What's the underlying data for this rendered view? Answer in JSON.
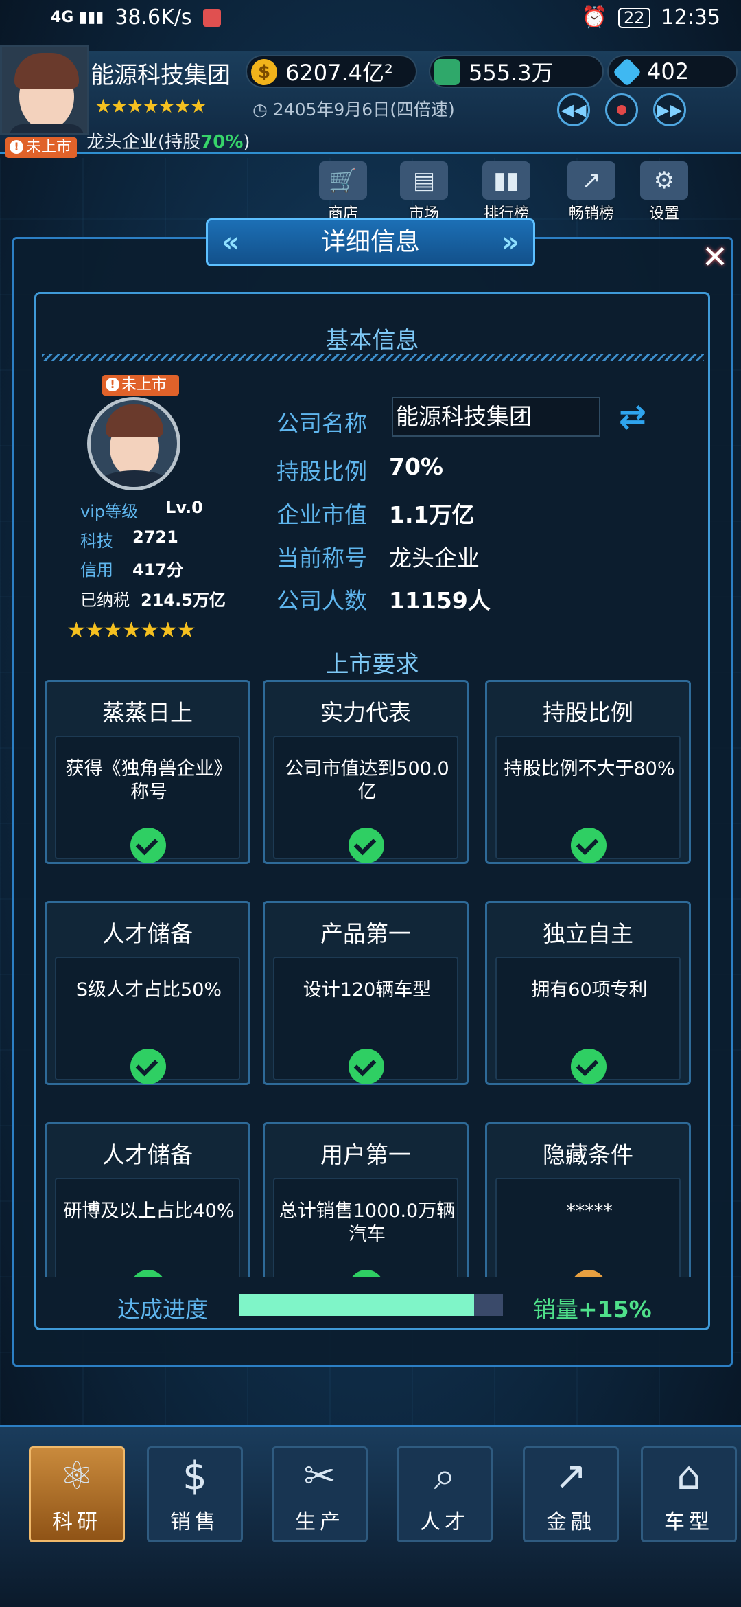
{
  "status_bar": {
    "network": "4G",
    "speed": "38.6K/s",
    "battery": "22",
    "time": "12:35"
  },
  "header": {
    "company_name": "能源科技集团",
    "gold": "6207.4亿²",
    "cash": "555.3万",
    "diamonds": "402",
    "stars": "★★★★★★★",
    "date": "2405年9月6日(四倍速)",
    "company_title_prefix": "龙头企业(持股",
    "company_title_percent": "70%",
    "company_title_suffix": ")",
    "listing_badge": "未上市"
  },
  "top_nav": [
    {
      "label": "商店",
      "icon": "cart-icon"
    },
    {
      "label": "市场",
      "icon": "book-icon"
    },
    {
      "label": "排行榜",
      "icon": "bar-chart-icon"
    },
    {
      "label": "畅销榜",
      "icon": "trend-chart-icon"
    },
    {
      "label": "设置",
      "icon": "gear-icon"
    }
  ],
  "dialog": {
    "title": "详细信息",
    "basic_info_title": "基本信息",
    "profile": {
      "badge": "未上市",
      "vip_label": "vip等级",
      "vip_value": "Lv.0",
      "tech_label": "科技",
      "tech_value": "2721",
      "credit_label": "信用",
      "credit_value": "417分",
      "tax_label": "已纳税",
      "tax_value": "214.5万亿",
      "stars": "★★★★★★★"
    },
    "fields": {
      "company_name_label": "公司名称",
      "company_name_value": "能源科技集团",
      "share_label": "持股比例",
      "share_value": "70%",
      "market_value_label": "企业市值",
      "market_value_value": "1.1万亿",
      "title_label": "当前称号",
      "title_value": "龙头企业",
      "staff_label": "公司人数",
      "staff_value": "11159人"
    },
    "requirements_title": "上市要求",
    "requirements": [
      {
        "title": "蒸蒸日上",
        "desc": "获得《独角兽企业》称号",
        "done": true
      },
      {
        "title": "实力代表",
        "desc": "公司市值达到500.0亿",
        "done": true
      },
      {
        "title": "持股比例",
        "desc": "持股比例不大于80%",
        "done": true
      },
      {
        "title": "人才储备",
        "desc": "S级人才占比50%",
        "done": true
      },
      {
        "title": "产品第一",
        "desc": "设计120辆车型",
        "done": true
      },
      {
        "title": "独立自主",
        "desc": "拥有60项专利",
        "done": true
      },
      {
        "title": "人才储备",
        "desc": "研博及以上占比40%",
        "done": true
      },
      {
        "title": "用户第一",
        "desc": "总计销售1000.0万辆汽车",
        "done": true
      },
      {
        "title": "隐藏条件",
        "desc": "*****",
        "done": false
      }
    ],
    "progress_label": "达成进度",
    "progress_value": 0.89,
    "bonus_label": "销量",
    "bonus_value": "+15%"
  },
  "bottom_nav": [
    {
      "label": "科研",
      "icon": "research-icon",
      "active": true
    },
    {
      "label": "销售",
      "icon": "sales-icon",
      "active": false
    },
    {
      "label": "生产",
      "icon": "tools-icon",
      "active": false
    },
    {
      "label": "人才",
      "icon": "talent-icon",
      "active": false
    },
    {
      "label": "金融",
      "icon": "finance-icon",
      "active": false
    },
    {
      "label": "车型",
      "icon": "garage-icon",
      "active": false
    }
  ],
  "colors": {
    "accent": "#2c7fc4",
    "label_blue": "#5fb6ee",
    "check_green": "#2fcf63",
    "progress_fill": "#7ff5c8",
    "bonus_green": "#4fe08a",
    "badge_orange": "#e0622a"
  }
}
